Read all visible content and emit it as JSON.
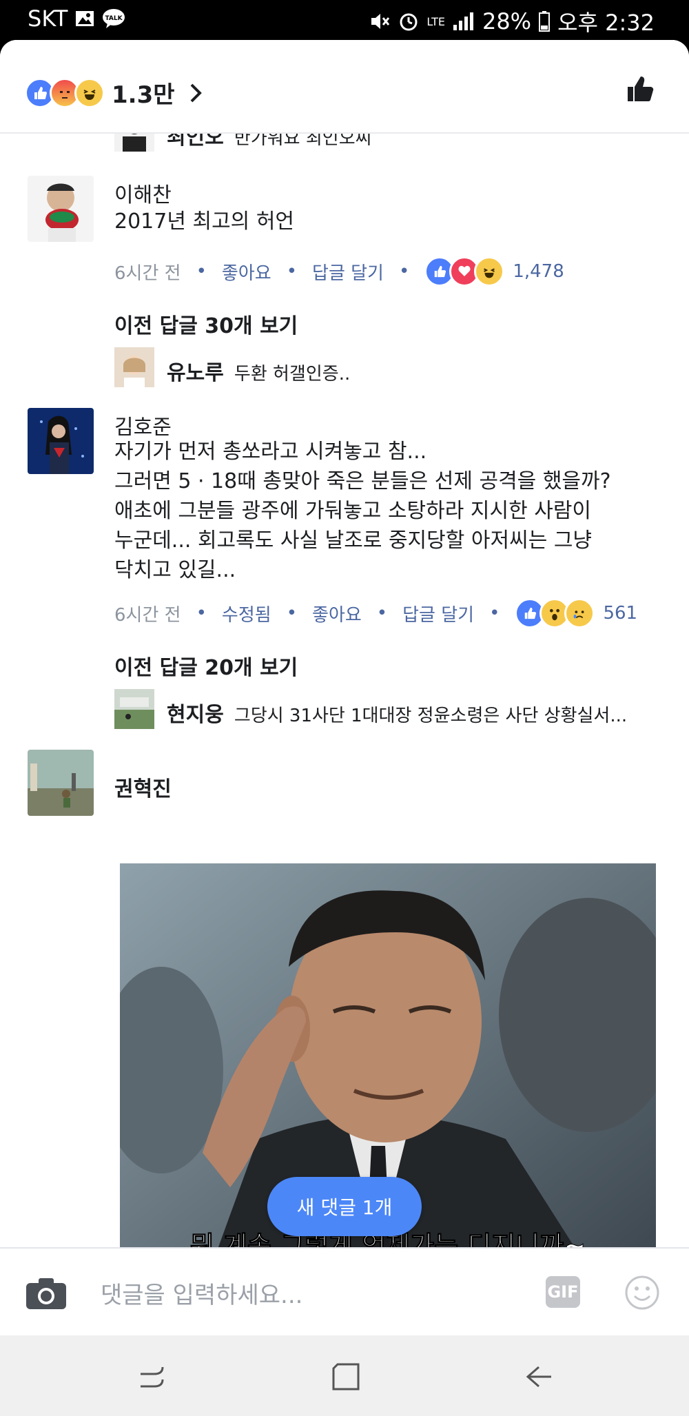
{
  "status_bar": {
    "carrier": "SKT",
    "network": "LTE",
    "battery": "28%",
    "time": "오후 2:32",
    "icons": [
      "image-icon",
      "talk-icon",
      "mute-icon",
      "alarm-icon",
      "signal-icon",
      "battery-icon"
    ]
  },
  "reactions_bar": {
    "count": "1.3만",
    "icons": [
      "like",
      "angry",
      "haha"
    ]
  },
  "partial_reply": {
    "name": "최인오",
    "text": "반가워요 최인오씨"
  },
  "comments": [
    {
      "name": "이해찬",
      "text": "2017년 최고의 허언",
      "time": "6시간 전",
      "like": "좋아요",
      "reply": "답글 달기",
      "reaction_count": "1,478",
      "reactions": [
        "like",
        "love",
        "haha"
      ],
      "more_replies": "이전 답글 30개 보기",
      "reply_preview": {
        "name": "유노루",
        "text": "두환 허갤인증.."
      }
    },
    {
      "name": "김호준",
      "lines": [
        "자기가 먼저 총쏘라고 시켜놓고 참...",
        "그러면 5 · 18때 총맞아 죽은 분들은 선제 공격을 했을까?",
        "애초에 그분들 광주에 가둬놓고 소탕하라 지시한 사람이",
        "누군데...  회고록도 사실 날조로 중지당할 아저씨는 그냥",
        "닥치고 있길..."
      ],
      "time": "6시간 전",
      "edited": "수정됨",
      "like": "좋아요",
      "reply": "답글 달기",
      "reaction_count": "561",
      "reactions": [
        "like",
        "wow",
        "sad"
      ],
      "more_replies": "이전 답글 20개 보기",
      "reply_preview": {
        "name": "현지웅",
        "text": "그당시 31사단 1대대장 정윤소령은 사단 상황실서..."
      }
    },
    {
      "name": "권혁진",
      "image_caption": "뭐 계속 그렇게 언제가는 디지니까~"
    }
  ],
  "new_comments_pill": "새 댓글 1개",
  "composer": {
    "placeholder": "댓글을 입력하세요...",
    "gif_label": "GIF"
  },
  "colors": {
    "link": "#4b67a1",
    "accent": "#4c87f8",
    "muted": "#8d949e"
  }
}
